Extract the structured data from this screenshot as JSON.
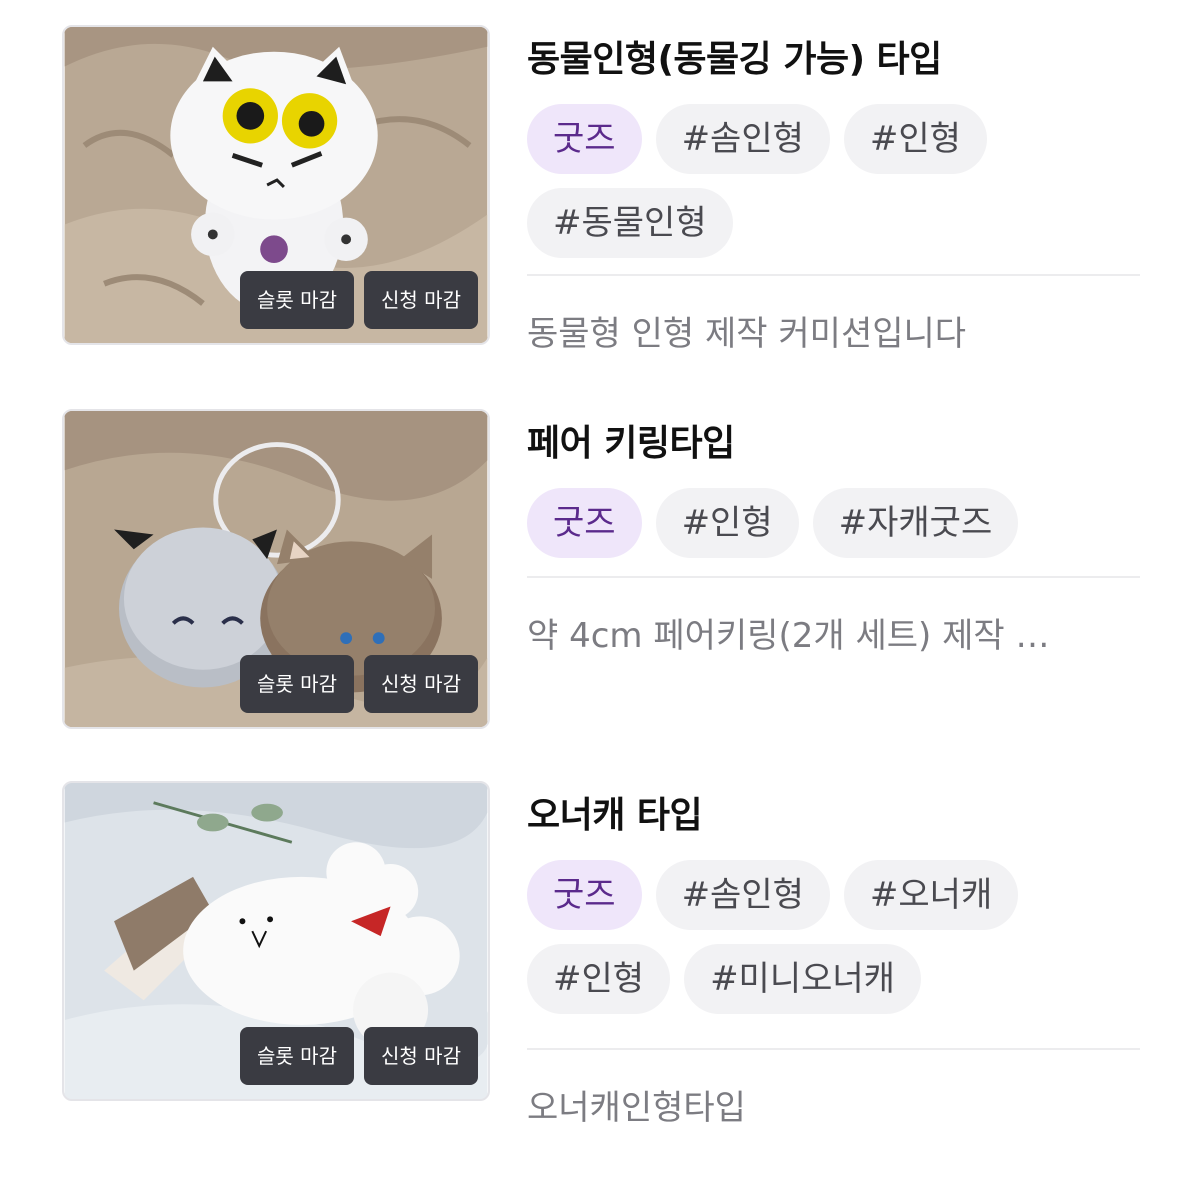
{
  "items": [
    {
      "title": "동물인형(동물깅 가능) 타입",
      "category": "굿즈",
      "tags": [
        "#솜인형",
        "#인형",
        "#동물인형"
      ],
      "description": "동물형 인형 제작 커미션입니다",
      "badges": {
        "slot": "슬롯 마감",
        "apply": "신청 마감"
      }
    },
    {
      "title": "페어 키링타입",
      "category": "굿즈",
      "tags": [
        "#인형",
        "#자캐굿즈"
      ],
      "description": "약 4cm 페어키링(2개 세트) 제작 …",
      "badges": {
        "slot": "슬롯 마감",
        "apply": "신청 마감"
      }
    },
    {
      "title": "오너캐 타입",
      "category": "굿즈",
      "tags": [
        "#솜인형",
        "#오너캐",
        "#인형",
        "#미니오너캐"
      ],
      "description": "오너캐인형타입",
      "badges": {
        "slot": "슬롯 마감",
        "apply": "신청 마감"
      }
    }
  ],
  "colors": {
    "category_tag_bg": "#efe6fa",
    "category_tag_text": "#5b2a8c",
    "tag_bg": "#f2f2f4",
    "badge_bg": "#3a3b42"
  }
}
